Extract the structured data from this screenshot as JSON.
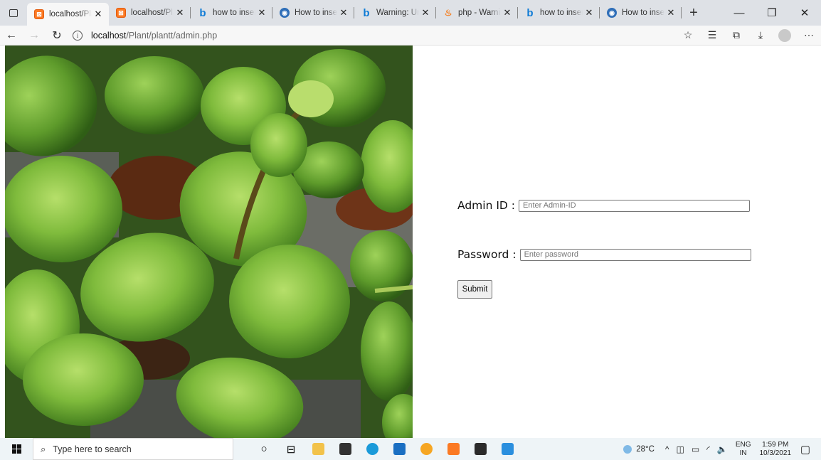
{
  "browser": {
    "tabs": [
      {
        "title": "localhost/Plant/plantt/admin.php",
        "favicon": "xampp-icon",
        "active": true
      },
      {
        "title": "localhost/Plant/plantt",
        "favicon": "xampp-icon",
        "active": false
      },
      {
        "title": "how to insert",
        "favicon": "bing-icon",
        "active": false
      },
      {
        "title": "How to insert",
        "favicon": "stackoverflow-icon",
        "active": false
      },
      {
        "title": "Warning: Undefined",
        "favicon": "bing-icon",
        "active": false
      },
      {
        "title": "php - Warning",
        "favicon": "php-icon",
        "active": false
      },
      {
        "title": "how to insert",
        "favicon": "bing-icon",
        "active": false
      },
      {
        "title": "How to insert",
        "favicon": "stackoverflow-icon",
        "active": false
      }
    ],
    "url_host": "localhost",
    "url_path": "/Plant/plantt/admin.php"
  },
  "form": {
    "admin_label": "Admin ID :",
    "admin_placeholder": "Enter Admin-ID",
    "password_label": "Password :",
    "password_placeholder": "Enter password",
    "submit_label": "Submit"
  },
  "taskbar": {
    "search_placeholder": "Type here to search",
    "temperature": "28°C",
    "language_top": "ENG",
    "language_bottom": "IN",
    "time": "1:59 PM",
    "date": "10/3/2021"
  },
  "colors": {
    "tab_strip": "#dee1e6",
    "xampp_orange": "#fb7a24",
    "bing_blue": "#0f7bd6",
    "taskbar": "#eef4f7"
  }
}
